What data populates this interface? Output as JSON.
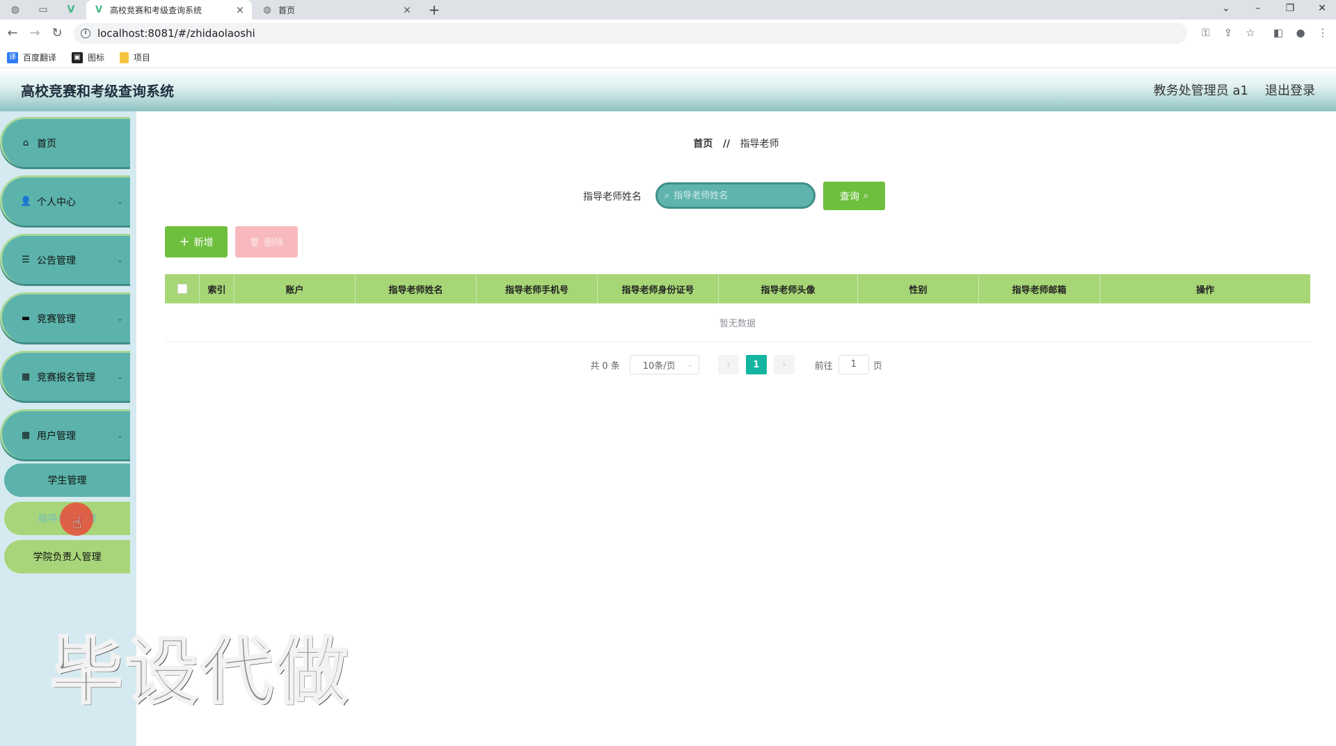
{
  "browser": {
    "tabs": [
      {
        "title": "高校竞赛和考级查询系统",
        "active": true
      },
      {
        "title": "首页",
        "active": false
      }
    ],
    "url": "localhost:8081/#/zhidaolaoshi",
    "bookmarks": [
      {
        "label": "百度翻译",
        "icon": "translate-icon",
        "color": "#2f7df6"
      },
      {
        "label": "图标",
        "icon": "image-icon",
        "color": "#222222"
      },
      {
        "label": "项目",
        "icon": "folder-icon",
        "color": "#f5c542"
      }
    ]
  },
  "header": {
    "title": "高校竞赛和考级查询系统",
    "user": "教务处管理员 a1",
    "logout": "退出登录"
  },
  "sidebar": {
    "items": [
      {
        "label": "首页",
        "icon": "home-icon",
        "has_arrow": false
      },
      {
        "label": "个人中心",
        "icon": "user-icon",
        "has_arrow": true
      },
      {
        "label": "公告管理",
        "icon": "sliders-icon",
        "has_arrow": true
      },
      {
        "label": "竞赛管理",
        "icon": "book-icon",
        "has_arrow": true
      },
      {
        "label": "竞赛报名管理",
        "icon": "grid-icon",
        "has_arrow": true
      },
      {
        "label": "用户管理",
        "icon": "grid-icon",
        "has_arrow": true
      }
    ],
    "sub_items": [
      {
        "label": "学生管理",
        "state": "normal"
      },
      {
        "label": "指导老师管理",
        "state": "active"
      },
      {
        "label": "学院负责人管理",
        "state": "normal"
      }
    ]
  },
  "breadcrumb": {
    "home": "首页",
    "separator": "//",
    "current": "指导老师"
  },
  "search": {
    "label": "指导老师姓名",
    "placeholder": "指导老师姓名",
    "value": "",
    "button": "查询"
  },
  "actions": {
    "add": "新增",
    "delete": "删除"
  },
  "table": {
    "columns": [
      "",
      "索引",
      "账户",
      "指导老师姓名",
      "指导老师手机号",
      "指导老师身份证号",
      "指导老师头像",
      "性别",
      "指导老师邮箱",
      "操作"
    ],
    "rows": [],
    "empty_text": "暂无数据"
  },
  "pagination": {
    "total": "共 0 条",
    "page_size": "10条/页",
    "current_page": "1",
    "goto_label": "前往",
    "goto_value": "1",
    "page_suffix": "页"
  },
  "watermark": "毕设代做",
  "colors": {
    "menu_teal": "#5cb3ab",
    "menu_green": "#a9d57a",
    "primary_green": "#6fbf3f",
    "header_green": "#a7d676",
    "page_active": "#13b5a0"
  }
}
